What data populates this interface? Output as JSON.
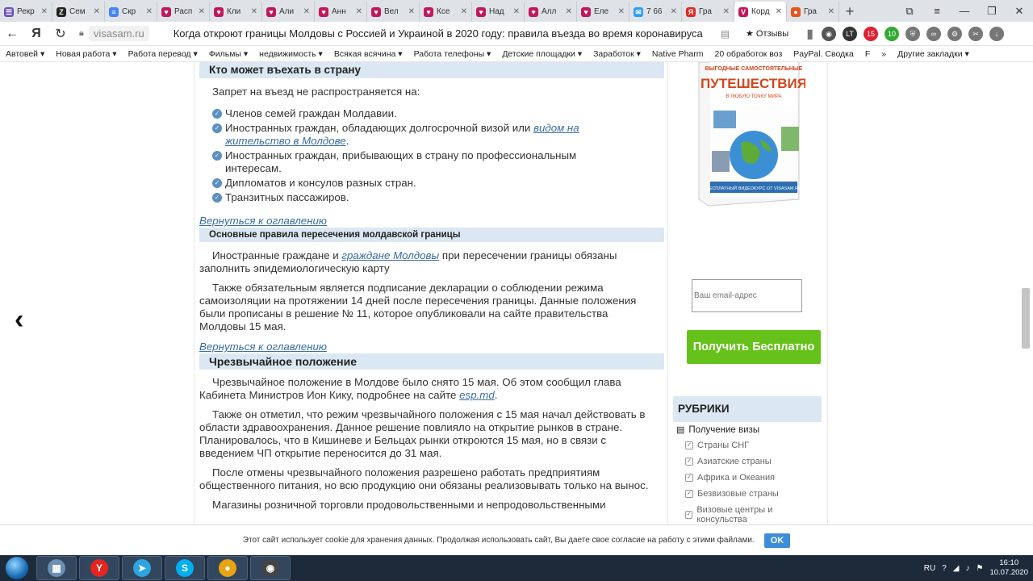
{
  "tabs": [
    {
      "label": "Рекр",
      "icon": "document-icon",
      "color": "#6a4fc4",
      "glyph": "☰"
    },
    {
      "label": "Сем",
      "icon": "z-icon",
      "color": "#222222",
      "glyph": "Z"
    },
    {
      "label": "Скр",
      "icon": "docs-icon",
      "color": "#4285f4",
      "glyph": "≡"
    },
    {
      "label": "Расп",
      "icon": "heart-icon",
      "color": "#c2185b",
      "glyph": "♥"
    },
    {
      "label": "Кли",
      "icon": "heart-icon",
      "color": "#c2185b",
      "glyph": "♥"
    },
    {
      "label": "Али",
      "icon": "heart-icon",
      "color": "#c2185b",
      "glyph": "♥"
    },
    {
      "label": "Анн",
      "icon": "heart-icon",
      "color": "#c2185b",
      "glyph": "♥"
    },
    {
      "label": "Вел",
      "icon": "heart-icon",
      "color": "#c2185b",
      "glyph": "♥"
    },
    {
      "label": "Ксе",
      "icon": "heart-icon",
      "color": "#c2185b",
      "glyph": "♥"
    },
    {
      "label": "Над",
      "icon": "heart-icon",
      "color": "#c2185b",
      "glyph": "♥"
    },
    {
      "label": "Алл",
      "icon": "heart-icon",
      "color": "#c2185b",
      "glyph": "♥"
    },
    {
      "label": "Еле",
      "icon": "heart-icon",
      "color": "#c2185b",
      "glyph": "♥"
    },
    {
      "label": "7 66",
      "icon": "chat-icon",
      "color": "#2a9df4",
      "glyph": "✉"
    },
    {
      "label": "Гра",
      "icon": "yandex-icon",
      "color": "#e52620",
      "glyph": "Я"
    },
    {
      "label": "Корд",
      "icon": "visasam-icon",
      "color": "#c2185b",
      "glyph": "V",
      "active": true
    },
    {
      "label": "Гра",
      "icon": "mushroom-icon",
      "color": "#e8541a",
      "glyph": "●"
    }
  ],
  "address": {
    "domain": "visasam.ru",
    "title": "Когда откроют границы Молдовы с Россией и Украиной в 2020 году: правила въезда во время коронавируса",
    "reviews": "★ Отзывы",
    "ext_badge_1": "15",
    "ext_badge_2": "10"
  },
  "bookmarks": [
    "Автовей ▾",
    "Новая работа ▾",
    "Работа перевод ▾",
    "Фильмы ▾",
    "недвижимость ▾",
    "Всякая всячина ▾",
    "Работа телефоны ▾",
    "Детские площадки ▾",
    "Заработок ▾",
    "Native Pharm",
    "20 обработок воз",
    "PayPal. Сводка",
    "F",
    "»",
    "Другие закладки ▾"
  ],
  "article": {
    "h1": "Кто может въехать в страну",
    "intro": "Запрет на въезд не распространяется на:",
    "list": [
      "Членов семей граждан Молдавии.",
      "Иностранных граждан, обладающих долгосрочной визой или",
      "Иностранных граждан, прибывающих в страну по профессиональным интересам.",
      "Дипломатов и консулов разных стран.",
      "Транзитных пассажиров."
    ],
    "list_link": "видом на жительство в Молдове",
    "back_link_1": "Вернуться к оглавлению",
    "h2": "Основные правила пересечения молдавской границы",
    "p1_a": "Иностранные граждане и",
    "p1_link": "граждане Молдовы",
    "p1_b": "при пересечении границы обязаны заполнить эпидемиологическую карту",
    "p2": "Также обязательным является подписание декларации о соблюдении режима самоизоляции на протяжении 14 дней после пересечения границы. Данные положения были прописаны в решение № 11, которое опубликовали на сайте правительства Молдовы 15 мая.",
    "back_link_2": "Вернуться к оглавлению",
    "h3": "Чрезвычайное положение",
    "p3_a": "Чрезвычайное положение в Молдове было снято 15 мая. Об этом сообщил глава Кабинета Министров Ион Кику, подробнее на сайте",
    "p3_link": "esp.md",
    "p4": "Также он отметил, что режим чрезвычайного положения с 15 мая начал действовать в области здравоохранения.  Данное решение повлияло на открытие рынков в стране. Планировалось, что в Кишиневе и Бельцах рынки откроются 15 мая, но в связи с введением ЧП открытие переносится до 31 мая.",
    "p5": "После отмены чрезвычайного положения разрешено работать предприятиям общественного питания, но всю продукцию они обязаны реализовывать только на вынос.",
    "p6": "Магазины розничной торговли продовольственными и непродовольственными"
  },
  "sidebar": {
    "book_top": "ВЫГОДНЫЕ САМОСТОЯТЕЛЬНЫЕ",
    "book_title": "ПУТЕШЕСТВИЯ",
    "book_sub": "В ЛЮБУЮ ТОЧКУ МИРА",
    "book_bottom": "БЕСПЛАТНЫЙ ВИДЕОКУРС ОТ VISASAM.RU",
    "email_placeholder": "Ваш email-адрес",
    "cta": "Получить Бесплатно",
    "rubrics_title": "РУБРИКИ",
    "rubrics_main": "Получение визы",
    "rubrics": [
      "Страны СНГ",
      "Азиатские страны",
      "Африка и Океания",
      "Безвизовые страны",
      "Визовые центры и консульства"
    ]
  },
  "cookie": {
    "text": "Этот сайт использует cookie для хранения данных. Продолжая использовать сайт, Вы даете свое согласие на работу с этими файлами.",
    "ok": "OK"
  },
  "taskbar": {
    "lang": "RU",
    "time": "16:10",
    "date": "10.07.2020",
    "apps": [
      {
        "name": "calculator",
        "glyph": "▦",
        "color": "#6b8fb3"
      },
      {
        "name": "yandex-browser",
        "glyph": "Y",
        "color": "#e52620"
      },
      {
        "name": "telegram",
        "glyph": "➤",
        "color": "#2ca5e0"
      },
      {
        "name": "skype",
        "glyph": "S",
        "color": "#00aff0"
      },
      {
        "name": "chrome",
        "glyph": "●",
        "color": "#e8a412"
      },
      {
        "name": "media",
        "glyph": "◉",
        "color": "#444444"
      }
    ]
  }
}
